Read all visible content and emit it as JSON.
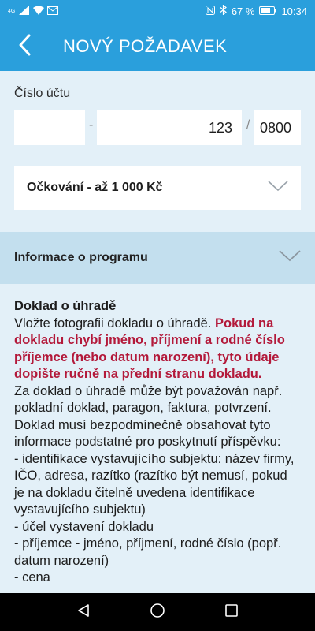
{
  "status_bar": {
    "network": "4G",
    "battery": "67 %",
    "time": "10:34",
    "icons": [
      "signal-icon",
      "wifi-icon",
      "mail-icon",
      "nfc-icon",
      "bluetooth-icon",
      "alarm-icon",
      "battery-icon"
    ]
  },
  "header": {
    "title": "NOVÝ POŽADAVEK",
    "back_icon": "chevron-left-icon"
  },
  "account": {
    "label": "Číslo účtu",
    "prefix_value": "",
    "separator1": "-",
    "number_value": "123",
    "separator2": "/",
    "bank_code_value": "0800"
  },
  "program_select": {
    "selected": "Očkování - až 1 000 Kč"
  },
  "accordion": {
    "label": "Informace o programu"
  },
  "info": {
    "heading": "Doklad o úhradě",
    "intro": "Vložte fotografii dokladu o úhradě. ",
    "warning": "Pokud na dokladu chybí jméno, příjmení a rodné číslo příjemce (nebo datum narození), tyto údaje dopište ručně na přední stranu dokladu.",
    "paragraph1": "Za doklad o úhradě může být považován např. pokladní doklad, paragon, faktura, potvrzení.",
    "paragraph2": "Doklad musí bezpodmínečně obsahovat tyto informace podstatné pro poskytnutí příspěvku:",
    "item1": "- identifikace vystavujícího subjektu: název firmy, IČO, adresa, razítko (razítko být nemusí, pokud je na dokladu čitelně uvedena identifikace vystavujícího subjektu)",
    "item2": "- účel vystavení dokladu",
    "item3": "- příjemce - jméno, příjmení, rodné číslo (popř. datum narození)",
    "item4": "- cena"
  },
  "nav_bar": {
    "icons": [
      "back-triangle-icon",
      "home-circle-icon",
      "recents-square-icon"
    ]
  },
  "colors": {
    "primary": "#2a9fdc",
    "background_light": "#e3f0f8",
    "accordion_bg": "#c3dfee",
    "warning_text": "#b3193a"
  }
}
